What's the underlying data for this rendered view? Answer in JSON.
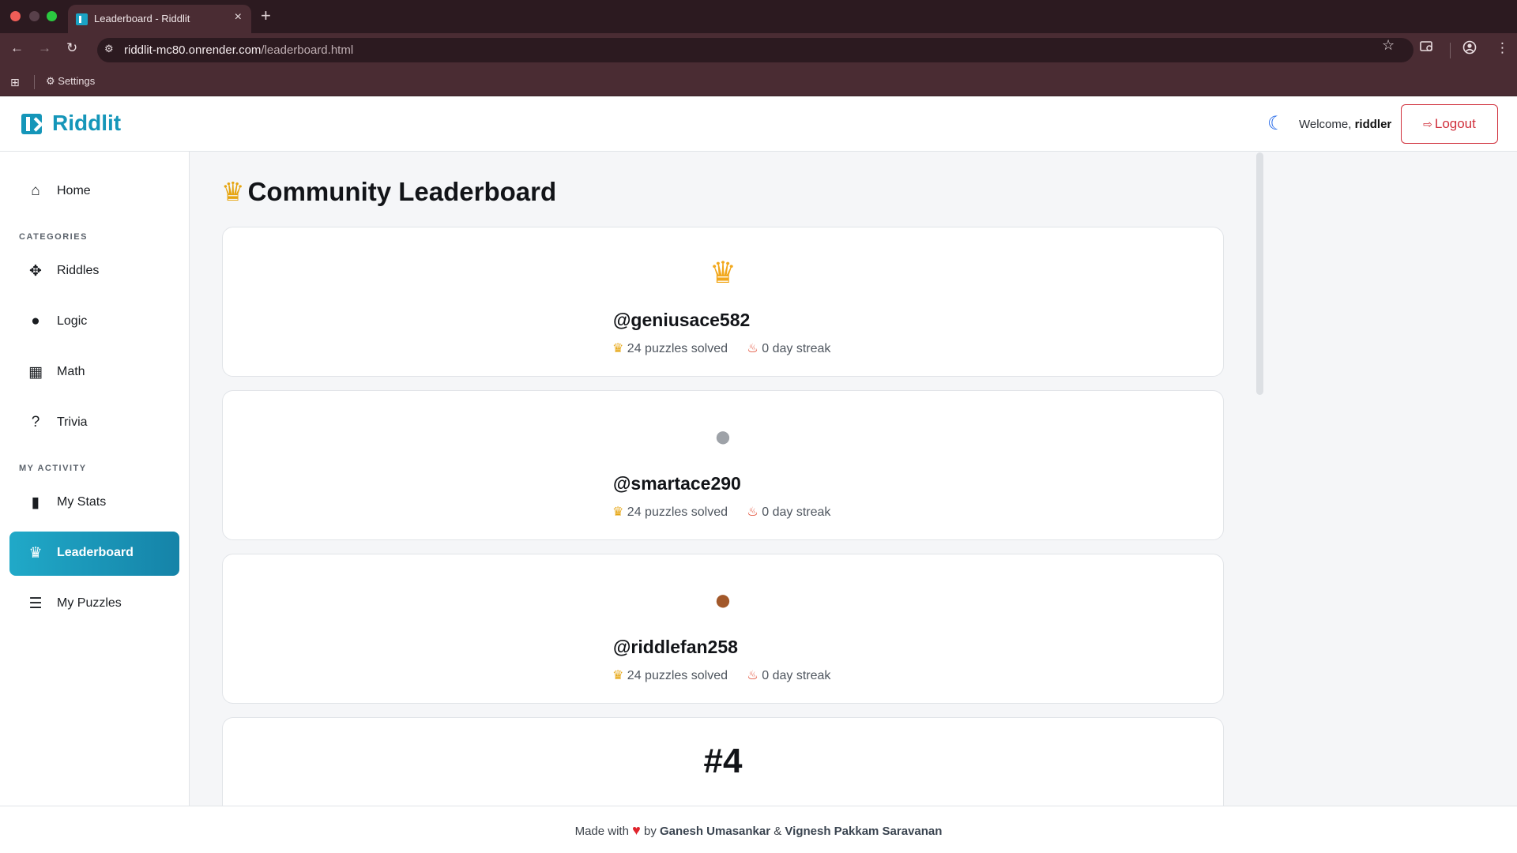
{
  "browser": {
    "tab_title": "Leaderboard - Riddlit",
    "close_glyph": "×",
    "new_tab_glyph": "+",
    "back_glyph": "←",
    "forward_glyph": "→",
    "reload_glyph": "↻",
    "site_info_glyph": "⚙",
    "url_host": "riddlit-mc80.onrender.com",
    "url_path": "/leaderboard.html",
    "bookmark_star_glyph": "☆",
    "bookmark_label": "Settings",
    "apps_glyph": "⊞",
    "settings_glyph": "⚙"
  },
  "header": {
    "brand": "Riddlit",
    "welcome_prefix": "Welcome, ",
    "username": "riddler",
    "logout_label": "Logout",
    "logout_glyph": "⇨",
    "theme_glyph": "☾"
  },
  "sidebar": {
    "home": {
      "label": "Home",
      "icon": "home-icon",
      "glyph": "⌂"
    },
    "categories_heading": "CATEGORIES",
    "categories": [
      {
        "label": "Riddles",
        "icon": "puzzle-icon",
        "glyph": "✥"
      },
      {
        "label": "Logic",
        "icon": "lightbulb-icon",
        "glyph": "●"
      },
      {
        "label": "Math",
        "icon": "calculator-icon",
        "glyph": "▦"
      },
      {
        "label": "Trivia",
        "icon": "question-circle-icon",
        "glyph": "?"
      }
    ],
    "activity_heading": "MY ACTIVITY",
    "activity": [
      {
        "label": "My Stats",
        "icon": "bar-chart-icon",
        "glyph": "▮"
      },
      {
        "label": "Leaderboard",
        "icon": "trophy-icon",
        "glyph": "♛",
        "active": true
      },
      {
        "label": "My Puzzles",
        "icon": "journal-icon",
        "glyph": "☰"
      }
    ]
  },
  "main": {
    "title": "Community Leaderboard",
    "title_glyph": "♛",
    "entries": [
      {
        "badge": "crown",
        "badge_glyph": "♛",
        "username": "@geniusace582",
        "solved": "24 puzzles solved",
        "streak": "0 day streak"
      },
      {
        "badge": "silver-medal",
        "badge_glyph": "●",
        "username": "@smartace290",
        "solved": "24 puzzles solved",
        "streak": "0 day streak"
      },
      {
        "badge": "bronze-medal",
        "badge_glyph": "●",
        "username": "@riddlefan258",
        "solved": "24 puzzles solved",
        "streak": "0 day streak"
      },
      {
        "badge": "rank",
        "rank_label": "#4"
      }
    ],
    "trophy_glyph": "♛",
    "fire_glyph": "♨"
  },
  "footer": {
    "prefix": "Made with ",
    "heart": "♥",
    "by": " by ",
    "author1": "Ganesh Umasankar",
    "amp": " & ",
    "author2": "Vignesh Pakkam Saravanan"
  },
  "colors": {
    "brand": "#1596b9",
    "active_nav": "#20a9c8",
    "logout": "#d0303c",
    "gold": "#f2a81d",
    "silver": "#9ea2a8",
    "bronze": "#a2582a",
    "browser_frame": "#4a2c33"
  }
}
